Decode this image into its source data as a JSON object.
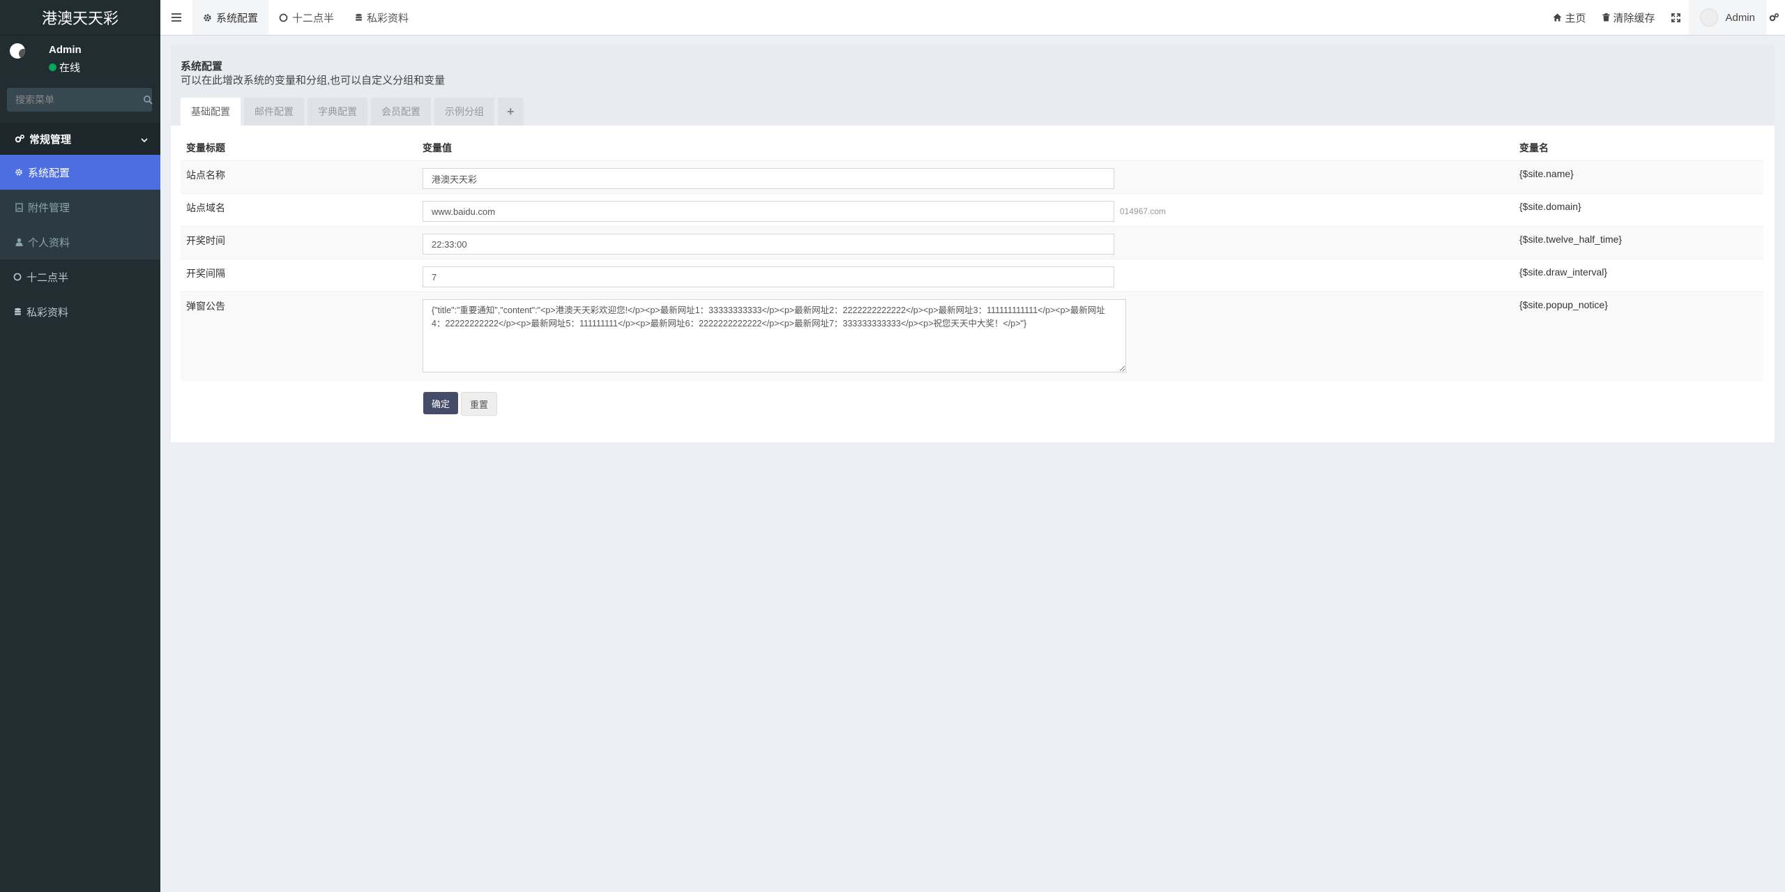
{
  "app": {
    "title": "港澳天天彩"
  },
  "user": {
    "name": "Admin",
    "status": "在线"
  },
  "sidebar": {
    "search_placeholder": "搜索菜单",
    "group": {
      "label": "常规管理"
    },
    "sub_items": [
      {
        "label": "系统配置",
        "icon": "gear-icon"
      },
      {
        "label": "附件管理",
        "icon": "file-image-icon"
      },
      {
        "label": "个人资料",
        "icon": "user-icon"
      }
    ],
    "items": [
      {
        "label": "十二点半",
        "icon": "circle-icon"
      },
      {
        "label": "私彩资料",
        "icon": "database-icon"
      }
    ]
  },
  "header": {
    "tabs": [
      {
        "label": "系统配置",
        "icon": "gear-icon"
      },
      {
        "label": "十二点半",
        "icon": "circle-icon"
      },
      {
        "label": "私彩资料",
        "icon": "database-icon"
      }
    ],
    "home": "主页",
    "clear_cache": "清除缓存",
    "user": "Admin"
  },
  "panel": {
    "title": "系统配置",
    "desc": "可以在此增改系统的变量和分组,也可以自定义分组和变量",
    "tabs": [
      "基础配置",
      "邮件配置",
      "字典配置",
      "会员配置",
      "示例分组"
    ],
    "add_tab": "+"
  },
  "table": {
    "headers": [
      "变量标题",
      "变量值",
      "变量名"
    ],
    "rows": [
      {
        "title": "站点名称",
        "value": "港澳天天彩",
        "suffix": "",
        "name": "{$site.name}"
      },
      {
        "title": "站点域名",
        "value": "www.baidu.com",
        "suffix": "014967.com",
        "name": "{$site.domain}"
      },
      {
        "title": "开奖时间",
        "value": "22:33:00",
        "suffix": "",
        "name": "{$site.twelve_half_time}"
      },
      {
        "title": "开奖间隔",
        "value": "7",
        "suffix": "",
        "name": "{$site.draw_interval}"
      },
      {
        "title": "弹窗公告",
        "value": "{\"title\":\"重要通知\",\"content\":\"<p>港澳天天彩欢迎您!</p><p>最新网址1：33333333333</p><p>最新网址2：2222222222222</p><p>最新网址3：111111111111</p><p>最新网址4：22222222222</p><p>最新网址5：111111111</p><p>最新网址6：2222222222222</p><p>最新网址7：333333333333</p><p>祝您天天中大奖！</p>\"}",
        "suffix": "",
        "name": "{$site.popup_notice}"
      }
    ]
  },
  "buttons": {
    "submit": "确定",
    "reset": "重置"
  },
  "colors": {
    "sidebar_bg": "#222d32",
    "active_item": "#4c6ee0",
    "primary_btn": "#444c69",
    "online": "#00a65a"
  }
}
